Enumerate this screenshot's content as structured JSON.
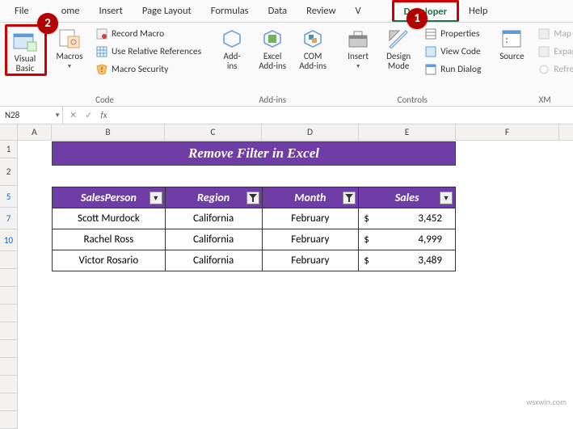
{
  "tabs": {
    "file": "File",
    "home": "ome",
    "insert": "Insert",
    "page_layout": "Page Layout",
    "formulas": "Formulas",
    "data": "Data",
    "review": "Review",
    "view": "V",
    "developer": "Developer",
    "help": "Help"
  },
  "ribbon": {
    "code": {
      "visual_basic": "Visual\nBasic",
      "macros": "Macros",
      "record": "Record Macro",
      "relative": "Use Relative References",
      "security": "Macro Security",
      "label": "Code"
    },
    "addins": {
      "addins": "Add-\nins",
      "excel": "Excel\nAdd-ins",
      "com": "COM\nAdd-ins",
      "label": "Add-ins"
    },
    "controls": {
      "insert": "Insert",
      "design": "Design\nMode",
      "properties": "Properties",
      "view_code": "View Code",
      "run_dialog": "Run Dialog",
      "label": "Controls"
    },
    "xml": {
      "source": "Source",
      "map": "Map Prop",
      "expansion": "Expansion",
      "refresh": "Refresh D",
      "label": "XM"
    }
  },
  "callouts": {
    "c1": "1",
    "c2": "2"
  },
  "namebox": "N28",
  "columns": [
    "A",
    "B",
    "C",
    "D",
    "E",
    "F"
  ],
  "row_headers": [
    "1",
    "2",
    "5",
    "7",
    "10",
    "",
    "",
    "",
    "",
    "",
    "",
    "",
    "",
    "",
    ""
  ],
  "sheet": {
    "title": "Remove Filter in Excel",
    "headers": {
      "h1": "SalesPerson",
      "h2": "Region",
      "h3": "Month",
      "h4": "Sales"
    },
    "rows": [
      {
        "person": "Scott Murdock",
        "region": "California",
        "month": "February",
        "currency": "$",
        "sales": "3,452"
      },
      {
        "person": "Rachel Ross",
        "region": "California",
        "month": "February",
        "currency": "$",
        "sales": "4,999"
      },
      {
        "person": "Victor Rosario",
        "region": "California",
        "month": "February",
        "currency": "$",
        "sales": "3,489"
      }
    ]
  },
  "watermark": "wsxwin.com",
  "chart_data": {
    "type": "table",
    "title": "Remove Filter in Excel",
    "columns": [
      "SalesPerson",
      "Region",
      "Month",
      "Sales"
    ],
    "rows": [
      [
        "Scott Murdock",
        "California",
        "February",
        3452
      ],
      [
        "Rachel Ross",
        "California",
        "February",
        4999
      ],
      [
        "Victor Rosario",
        "California",
        "February",
        3489
      ]
    ]
  }
}
